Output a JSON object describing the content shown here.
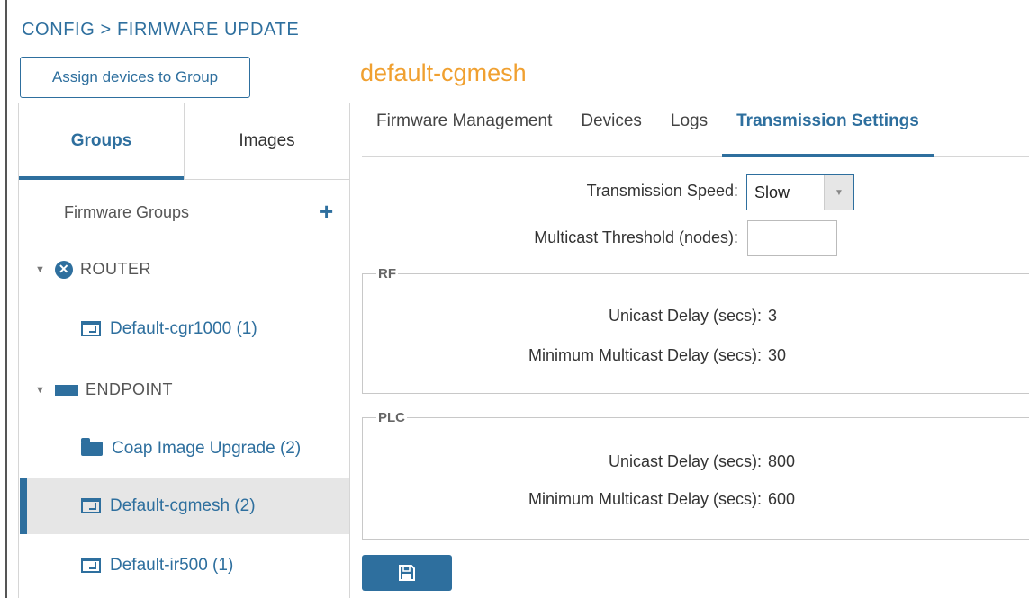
{
  "breadcrumb": "CONFIG > FIRMWARE UPDATE",
  "assign_button": "Assign devices to Group",
  "sidebar": {
    "tabs": [
      {
        "label": "Groups",
        "active": true
      },
      {
        "label": "Images",
        "active": false
      }
    ],
    "firmware_groups_label": "Firmware Groups",
    "add_icon": "+",
    "sections": [
      {
        "label": "ROUTER",
        "icon": "router-icon",
        "items": [
          {
            "label": "Default-cgr1000 (1)",
            "icon": "window-icon",
            "selected": false
          }
        ]
      },
      {
        "label": "ENDPOINT",
        "icon": "endpoint-icon",
        "items": [
          {
            "label": "Coap Image Upgrade (2)",
            "icon": "folder-icon",
            "selected": false
          },
          {
            "label": "Default-cgmesh (2)",
            "icon": "window-icon",
            "selected": true
          },
          {
            "label": "Default-ir500 (1)",
            "icon": "window-icon",
            "selected": false
          }
        ]
      }
    ]
  },
  "main": {
    "group_title": "default-cgmesh",
    "tabs": [
      {
        "label": "Firmware Management",
        "active": false
      },
      {
        "label": "Devices",
        "active": false
      },
      {
        "label": "Logs",
        "active": false
      },
      {
        "label": "Transmission Settings",
        "active": true
      }
    ],
    "transmission_speed_label": "Transmission Speed:",
    "transmission_speed_value": "Slow",
    "multicast_threshold_label": "Multicast Threshold (nodes):",
    "multicast_threshold_value": "",
    "rf": {
      "legend": "RF",
      "unicast_delay_label": "Unicast Delay (secs):",
      "unicast_delay_value": "3",
      "min_multicast_delay_label": "Minimum Multicast Delay (secs):",
      "min_multicast_delay_value": "30"
    },
    "plc": {
      "legend": "PLC",
      "unicast_delay_label": "Unicast Delay (secs):",
      "unicast_delay_value": "800",
      "min_multicast_delay_label": "Minimum Multicast Delay (secs):",
      "min_multicast_delay_value": "600"
    },
    "save_icon": "save-icon"
  },
  "colors": {
    "accent": "#2e6f9e",
    "title_orange": "#f0a030",
    "selected_bg": "#e6e6e6"
  }
}
